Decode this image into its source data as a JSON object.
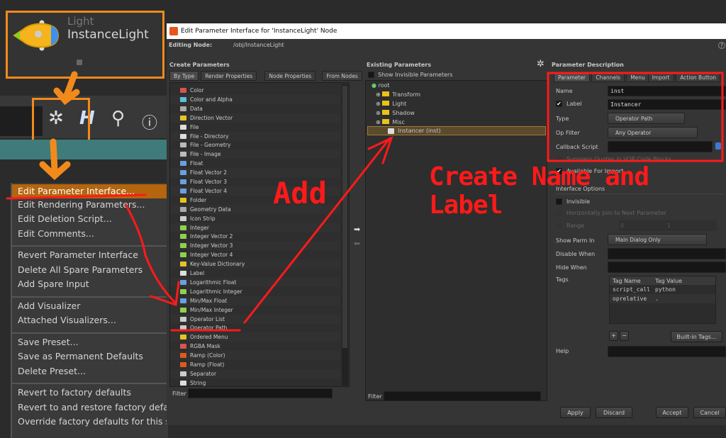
{
  "node": {
    "type": "Light",
    "name": "InstanceLight"
  },
  "menu": {
    "items": [
      {
        "label": "Edit Parameter Interface...",
        "highlight": true
      },
      {
        "label": "Edit Rendering Parameters..."
      },
      {
        "label": "Edit Deletion Script..."
      },
      {
        "label": "Edit Comments..."
      },
      {
        "sep": true
      },
      {
        "label": "Revert Parameter Interface"
      },
      {
        "label": "Delete All Spare Parameters"
      },
      {
        "label": "Add Spare Input"
      },
      {
        "sep": true
      },
      {
        "label": "Add Visualizer"
      },
      {
        "label": "Attached Visualizers..."
      },
      {
        "sep": true
      },
      {
        "label": "Save Preset..."
      },
      {
        "label": "Save as Permanent Defaults"
      },
      {
        "label": "Delete Preset..."
      },
      {
        "sep": true
      },
      {
        "label": "Revert to factory defaults"
      },
      {
        "label": "Revert to and restore factory defaults"
      },
      {
        "label": "Override factory defaults for this session"
      }
    ]
  },
  "dialog": {
    "title": "Edit Parameter Interface for 'InstanceLight' Node",
    "editing_node_label": "Editing Node:",
    "editing_node_value": "/obj/InstanceLight",
    "help_icon": "?",
    "create": {
      "title": "Create Parameters",
      "tabs": [
        "By Type",
        "Render Properties",
        "Node Properties",
        "From Nodes"
      ],
      "items": [
        [
          "Color",
          "#d9534f"
        ],
        [
          "Color and Alpha",
          "#5bc0de"
        ],
        [
          "Data",
          "#aaaaaa"
        ],
        [
          "Direction Vector",
          "#e6c229"
        ],
        [
          "File",
          "#dddddd"
        ],
        [
          "File - Directory",
          "#dddddd"
        ],
        [
          "File - Geometry",
          "#bbbbbb"
        ],
        [
          "File - Image",
          "#bbbbbb"
        ],
        [
          "Float",
          "#6aa0e0"
        ],
        [
          "Float Vector 2",
          "#6aa0e0"
        ],
        [
          "Float Vector 3",
          "#6aa0e0"
        ],
        [
          "Float Vector 4",
          "#6aa0e0"
        ],
        [
          "Folder",
          "#e8c31a"
        ],
        [
          "Geometry Data",
          "#aaaaaa"
        ],
        [
          "Icon Strip",
          "#cccccc"
        ],
        [
          "Integer",
          "#8fd14f"
        ],
        [
          "Integer Vector 2",
          "#8fd14f"
        ],
        [
          "Integer Vector 3",
          "#8fd14f"
        ],
        [
          "Integer Vector 4",
          "#8fd14f"
        ],
        [
          "Key-Value Dictionary",
          "#e6c229"
        ],
        [
          "Label",
          "#dddddd"
        ],
        [
          "Logarithmic Float",
          "#6aa0e0"
        ],
        [
          "Logarithmic Integer",
          "#8fd14f"
        ],
        [
          "Min/Max Float",
          "#6aa0e0"
        ],
        [
          "Min/Max Integer",
          "#8fd14f"
        ],
        [
          "Operator List",
          "#cccccc"
        ],
        [
          "Operator Path",
          "#cccccc"
        ],
        [
          "Ordered Menu",
          "#e6c229"
        ],
        [
          "RGBA Mask",
          "#d9534f"
        ],
        [
          "Ramp (Color)",
          "#e05a1a"
        ],
        [
          "Ramp (Float)",
          "#e05a1a"
        ],
        [
          "Separator",
          "#cccccc"
        ],
        [
          "String",
          "#dddddd"
        ]
      ],
      "filter_label": "Filter"
    },
    "existing": {
      "title": "Existing Parameters",
      "show_invisible": "Show Invisible Parameters",
      "root": "root",
      "folders": [
        "Transform",
        "Light",
        "Shadow",
        "Misc"
      ],
      "selected": "Instancer (inst)",
      "filter_label": "Filter"
    },
    "desc": {
      "title": "Parameter Description",
      "tabs": [
        "Parameter",
        "Channels",
        "Menu",
        "Import",
        "Action Button"
      ],
      "name_label": "Name",
      "name_value": "inst",
      "label_label": "Label",
      "label_value": "Instancer",
      "type_label": "Type",
      "type_value": "Operator Path",
      "opfilter_label": "Op Filter",
      "opfilter_value": "Any Operator",
      "callback_label": "Callback Script",
      "suppress": "Suppress Quotes in VOP Code Blocks",
      "available": "Available For Import",
      "interface_options": "Interface Options",
      "invisible": "Invisible",
      "hjoin": "Horizontally Join to Next Parameter",
      "range": "Range",
      "range_min": "0",
      "range_max": "1",
      "showparm_label": "Show Parm In",
      "showparm_value": "Main Dialog Only",
      "disable_when": "Disable When",
      "hide_when": "Hide When",
      "tags_label": "Tags",
      "tag_headers": [
        "Tag Name",
        "Tag Value"
      ],
      "tags": [
        [
          "script_call",
          "python"
        ],
        [
          "oprelative",
          "."
        ]
      ],
      "add": "+",
      "remove": "−",
      "builtin": "Built-in Tags...",
      "help_label": "Help"
    },
    "buttons": {
      "apply": "Apply",
      "discard": "Discard",
      "accept": "Accept",
      "cancel": "Cancel"
    }
  },
  "annotations": {
    "add": "Add",
    "create": "Create Name and Label",
    "color": "#ff1a1a",
    "callout_color": "#f28a1b"
  }
}
